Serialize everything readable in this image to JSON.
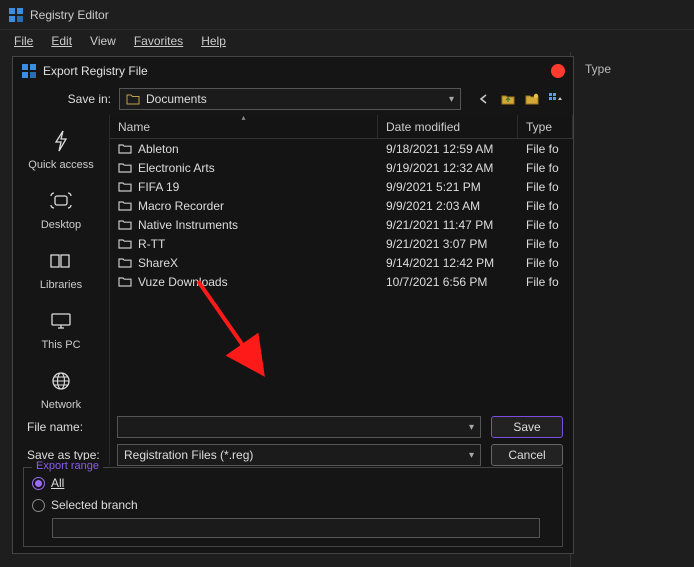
{
  "app": {
    "title": "Registry Editor"
  },
  "menubar": {
    "file": "File",
    "edit": "Edit",
    "view": "View",
    "favorites": "Favorites",
    "help": "Help"
  },
  "right_panel": {
    "type_header": "Type"
  },
  "dialog": {
    "title": "Export Registry File",
    "save_in_label": "Save in:",
    "save_in_value": "Documents",
    "columns": {
      "name": "Name",
      "date": "Date modified",
      "type": "Type"
    },
    "files": [
      {
        "name": "Ableton",
        "date": "9/18/2021 12:59 AM",
        "type": "File fo"
      },
      {
        "name": "Electronic Arts",
        "date": "9/19/2021 12:32 AM",
        "type": "File fo"
      },
      {
        "name": "FIFA 19",
        "date": "9/9/2021 5:21 PM",
        "type": "File fo"
      },
      {
        "name": "Macro Recorder",
        "date": "9/9/2021 2:03 AM",
        "type": "File fo"
      },
      {
        "name": "Native Instruments",
        "date": "9/21/2021 11:47 PM",
        "type": "File fo"
      },
      {
        "name": "R-TT",
        "date": "9/21/2021 3:07 PM",
        "type": "File fo"
      },
      {
        "name": "ShareX",
        "date": "9/14/2021 12:42 PM",
        "type": "File fo"
      },
      {
        "name": "Vuze Downloads",
        "date": "10/7/2021 6:56 PM",
        "type": "File fo"
      }
    ],
    "nav": {
      "quick_access": "Quick access",
      "desktop": "Desktop",
      "libraries": "Libraries",
      "this_pc": "This PC",
      "network": "Network"
    },
    "filename_label": "File name:",
    "filename_value": "",
    "filetype_label": "Save as type:",
    "filetype_value": "Registration Files (*.reg)",
    "save_btn": "Save",
    "cancel_btn": "Cancel",
    "export_range": {
      "legend": "Export range",
      "all": "All",
      "selected_branch": "Selected branch",
      "selected": "all",
      "branch_value": ""
    }
  }
}
